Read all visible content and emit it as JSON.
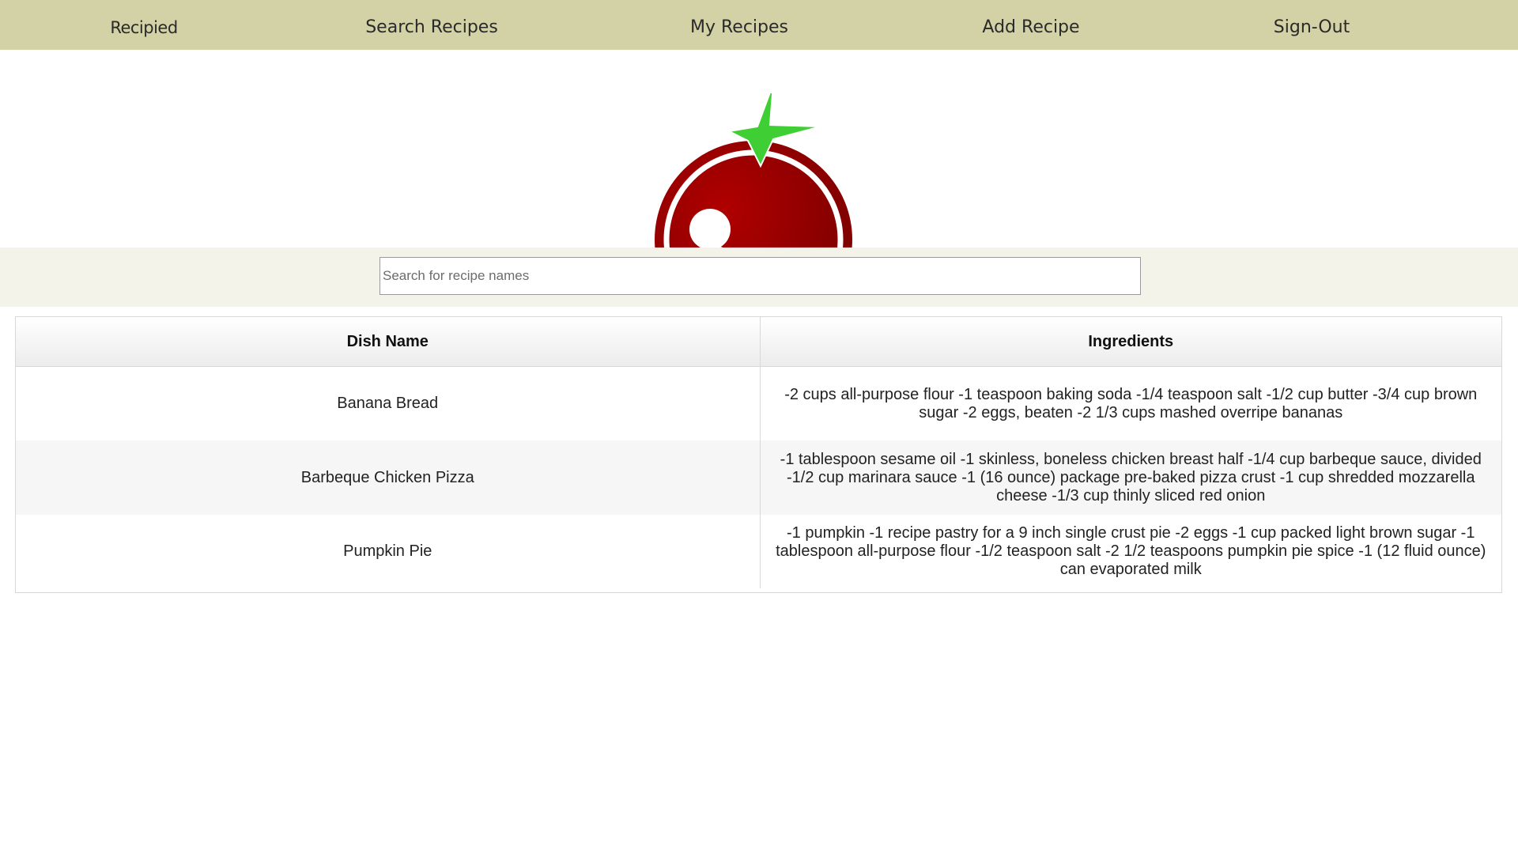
{
  "nav": {
    "brand": "Recipied",
    "search_recipes": "Search Recipes",
    "my_recipes": "My Recipes",
    "add_recipe": "Add Recipe",
    "sign_out": "Sign-Out"
  },
  "colors": {
    "nav_bg": "#d2d2a6",
    "search_band_bg": "#f3f3ea",
    "logo_red": "#8e0000",
    "logo_green": "#3fcf35"
  },
  "logo": {
    "icon": "tomato-logo-icon"
  },
  "search": {
    "placeholder": "Search for recipe names",
    "value": ""
  },
  "table": {
    "headers": [
      "Dish Name",
      "Ingredients"
    ],
    "rows": [
      {
        "dish": "Banana Bread",
        "ingredients": "-2 cups all-purpose flour -1 teaspoon baking soda -1/4 teaspoon salt -1/2 cup butter -3/4 cup brown sugar -2 eggs, beaten -2 1/3 cups mashed overripe bananas"
      },
      {
        "dish": "Barbeque Chicken Pizza",
        "ingredients": "-1 tablespoon sesame oil -1 skinless, boneless chicken breast half -1/4 cup barbeque sauce, divided -1/2 cup marinara sauce -1 (16 ounce) package pre-baked pizza crust -1 cup shredded mozzarella cheese -1/3 cup thinly sliced red onion"
      },
      {
        "dish": "Pumpkin Pie",
        "ingredients": "-1 pumpkin -1 recipe pastry for a 9 inch single crust pie -2 eggs -1 cup packed light brown sugar -1 tablespoon all-purpose flour -1/2 teaspoon salt -2 1/2 teaspoons pumpkin pie spice -1 (12 fluid ounce) can evaporated milk"
      }
    ]
  }
}
